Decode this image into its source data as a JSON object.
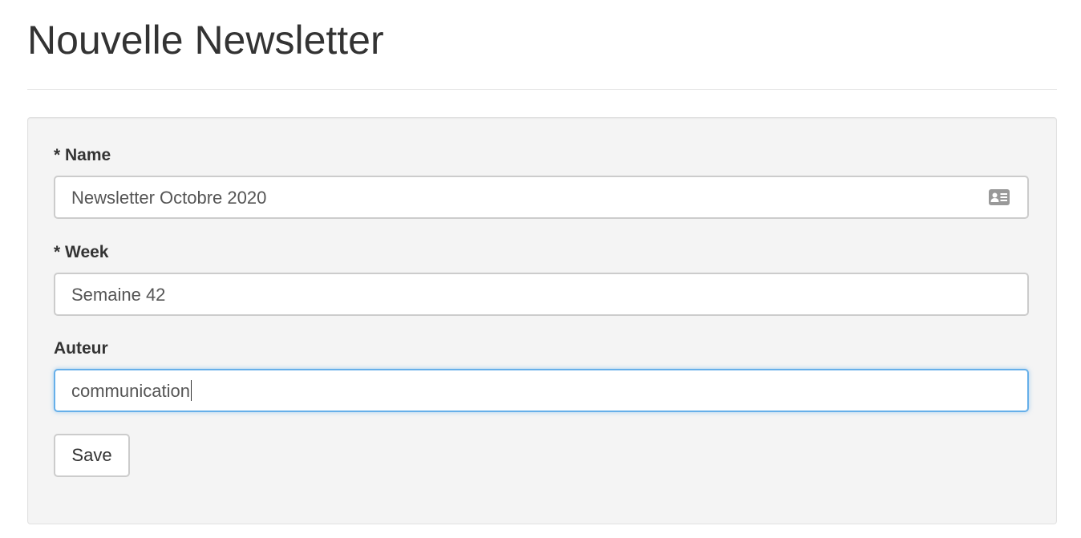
{
  "page": {
    "title": "Nouvelle Newsletter"
  },
  "form": {
    "name": {
      "label": "* Name",
      "value": "Newsletter Octobre 2020",
      "icon": "contact-card-icon"
    },
    "week": {
      "label": "* Week",
      "value": "Semaine 42"
    },
    "author": {
      "label": "Auteur",
      "value": "communication",
      "focused": true
    },
    "save_label": "Save"
  },
  "colors": {
    "focus_border": "#66afe9",
    "panel_background": "#f4f4f4",
    "input_border": "#cccccc",
    "icon": "#999999"
  }
}
